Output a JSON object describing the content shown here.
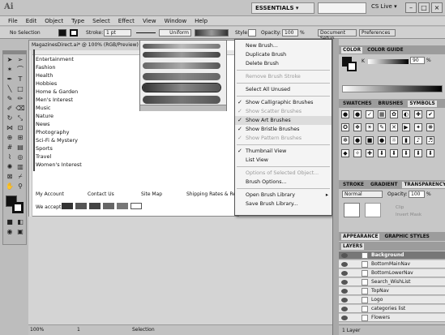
{
  "app": {
    "logo": "Ai",
    "workspace": "ESSENTIALS ▾",
    "cs_live": "CS Live ▾",
    "window_buttons": [
      "–",
      "□",
      "×"
    ]
  },
  "menubar": [
    "File",
    "Edit",
    "Object",
    "Type",
    "Select",
    "Effect",
    "View",
    "Window",
    "Help"
  ],
  "control": {
    "selection": "No Selection",
    "stroke_label": "Stroke:",
    "stroke_value": "1 pt",
    "profile": "Uniform",
    "style_label": "Style:",
    "opacity_label": "Opacity:",
    "opacity_value": "100",
    "unit": "%",
    "doc_setup": "Document Setup",
    "preferences": "Preferences"
  },
  "document": {
    "tab": "MagazinesDirect.ai* @ 100% (RGB/Preview)",
    "nav": [
      "Entertainment",
      "Fashion",
      "Health",
      "Hobbies",
      "Home & Garden",
      "Men's Interest",
      "Music",
      "Nature",
      "News",
      "Photography",
      "Sci-Fi & Mystery",
      "Sports",
      "Travel",
      "Women's Interest"
    ],
    "footer_links": [
      "My Account",
      "Contact Us",
      "Site Map",
      "Shipping Rates & Re"
    ],
    "we_accept": "We accept:"
  },
  "status": {
    "zoom": "100%",
    "page": "1",
    "tool": "Selection"
  },
  "brush_menu": {
    "items": [
      {
        "label": "New Brush...",
        "disabled": false,
        "checked": false
      },
      {
        "label": "Duplicate Brush",
        "disabled": false,
        "checked": false
      },
      {
        "label": "Delete Brush",
        "disabled": false,
        "checked": false
      },
      {
        "sep": true
      },
      {
        "label": "Remove Brush Stroke",
        "disabled": true,
        "checked": false
      },
      {
        "sep": true
      },
      {
        "label": "Select All Unused",
        "disabled": false,
        "checked": false
      },
      {
        "sep": true
      },
      {
        "label": "Show Calligraphic Brushes",
        "disabled": false,
        "checked": true
      },
      {
        "label": "Show Scatter Brushes",
        "disabled": true,
        "checked": true
      },
      {
        "label": "Show Art Brushes",
        "disabled": false,
        "checked": true,
        "highlight": true
      },
      {
        "label": "Show Bristle Brushes",
        "disabled": false,
        "checked": true
      },
      {
        "label": "Show Pattern Brushes",
        "disabled": true,
        "checked": true
      },
      {
        "sep": true
      },
      {
        "label": "Thumbnail View",
        "disabled": false,
        "checked": true
      },
      {
        "label": "List View",
        "disabled": false,
        "checked": false
      },
      {
        "sep": true
      },
      {
        "label": "Options of Selected Object...",
        "disabled": true,
        "checked": false
      },
      {
        "label": "Brush Options...",
        "disabled": false,
        "checked": false
      },
      {
        "sep": true
      },
      {
        "label": "Open Brush Library",
        "disabled": false,
        "checked": false,
        "submenu": true
      },
      {
        "label": "Save Brush Library...",
        "disabled": false,
        "checked": false
      }
    ]
  },
  "color_panel": {
    "tabs": [
      "COLOR",
      "COLOR GUIDE"
    ],
    "k_label": "K",
    "k_value": "90",
    "unit": "%"
  },
  "swatch_panel": {
    "tabs": [
      "SWATCHES",
      "BRUSHES",
      "SYMBOLS"
    ]
  },
  "stroke_panel": {
    "tabs": [
      "STROKE",
      "GRADIENT",
      "TRANSPARENCY"
    ],
    "mode": "Normal",
    "opacity_label": "Opacity:",
    "opacity_value": "100",
    "unit": "%",
    "clip": "Clip",
    "invert": "Invert Mask"
  },
  "appearance_panel": {
    "tabs": [
      "APPEARANCE",
      "GRAPHIC STYLES"
    ]
  },
  "layers_panel": {
    "title": "LAYERS",
    "rows": [
      "Background",
      "BottomMainNav",
      "BottomLowerNav",
      "Search_WishList",
      "TopNav",
      "Logo",
      "categories list",
      "Flowers"
    ],
    "count": "1 Layer"
  },
  "colors": {
    "accent": "#5b5b5b",
    "highlight": "#dcdcdc"
  }
}
